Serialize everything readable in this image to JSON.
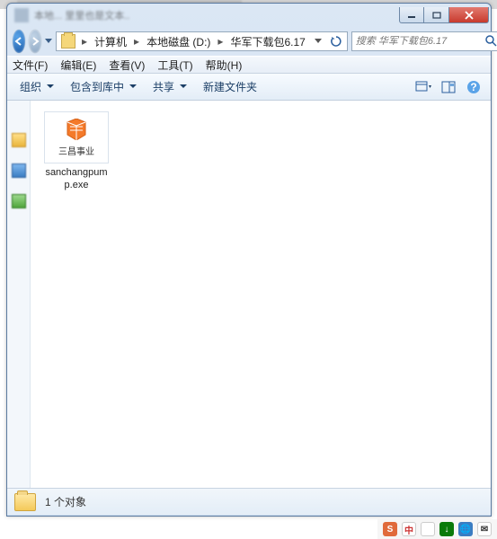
{
  "titlebar": {
    "blur_text": "本地... 里里也是文本.."
  },
  "breadcrumb": {
    "seg1": "计算机",
    "seg2": "本地磁盘 (D:)",
    "seg3": "华军下载包6.17"
  },
  "search": {
    "placeholder": "搜索 华军下载包6.17"
  },
  "menu": {
    "file": "文件(F)",
    "edit": "编辑(E)",
    "view": "查看(V)",
    "tools": "工具(T)",
    "help": "帮助(H)"
  },
  "toolbar": {
    "organize": "组织",
    "include": "包含到库中",
    "share": "共享",
    "newfolder": "新建文件夹"
  },
  "file": {
    "caption": "三昌事业",
    "name": "sanchangpump.exe"
  },
  "status": {
    "text": "1 个对象"
  }
}
